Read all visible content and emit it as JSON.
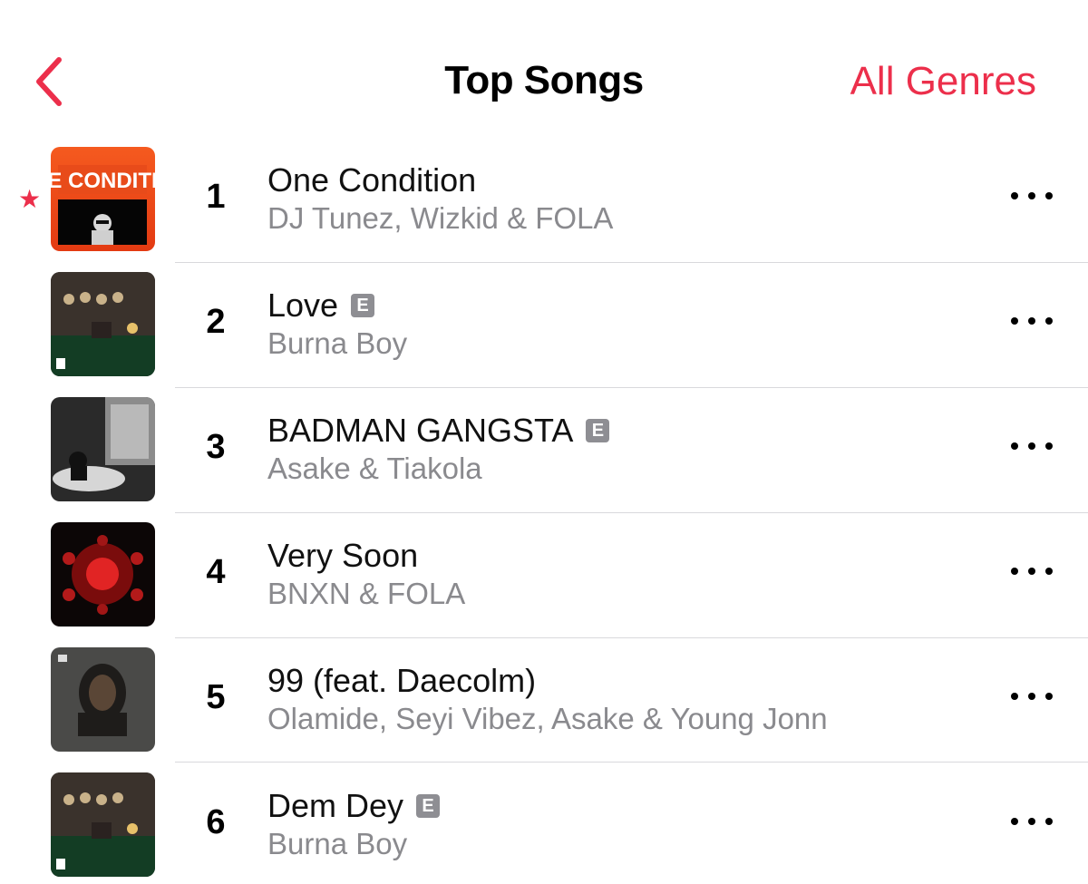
{
  "header": {
    "title": "Top Songs",
    "genres_label": "All Genres"
  },
  "colors": {
    "accent": "#ec2f4b",
    "secondary_text": "#8a8a8e",
    "explicit_badge": "#8e8e93"
  },
  "icons": {
    "back": "chevron-left-icon",
    "more": "ellipsis-icon",
    "favorite": "star-icon"
  },
  "songs": [
    {
      "rank": "1",
      "title": "One Condition",
      "artist": "DJ Tunez, Wizkid & FOLA",
      "explicit": false,
      "favorite": true,
      "explicit_label": "",
      "art_text": "ONE CONDITION"
    },
    {
      "rank": "2",
      "title": "Love",
      "artist": "Burna Boy",
      "explicit": true,
      "explicit_label": "E"
    },
    {
      "rank": "3",
      "title": "BADMAN GANGSTA",
      "artist": "Asake & Tiakola",
      "explicit": true,
      "explicit_label": "E"
    },
    {
      "rank": "4",
      "title": "Very Soon",
      "artist": "BNXN & FOLA",
      "explicit": false,
      "explicit_label": ""
    },
    {
      "rank": "5",
      "title": "99 (feat. Daecolm)",
      "artist": "Olamide, Seyi Vibez, Asake & Young Jonn",
      "explicit": false,
      "explicit_label": ""
    },
    {
      "rank": "6",
      "title": "Dem Dey",
      "artist": "Burna Boy",
      "explicit": true,
      "explicit_label": "E"
    }
  ]
}
